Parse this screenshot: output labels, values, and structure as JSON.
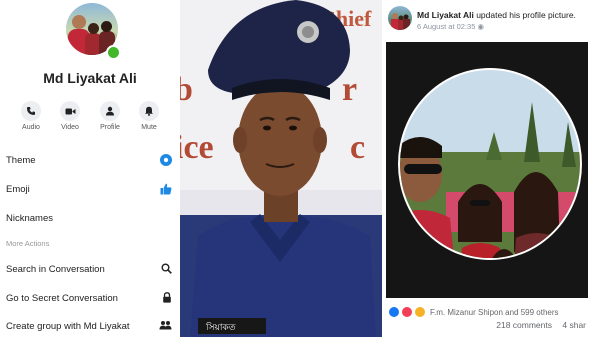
{
  "messenger": {
    "profile_name": "Md Liyakat Ali",
    "actions": [
      {
        "label": "Audio",
        "icon": "phone-icon"
      },
      {
        "label": "Video",
        "icon": "video-camera-icon"
      },
      {
        "label": "Profile",
        "icon": "profile-icon"
      },
      {
        "label": "Mute",
        "icon": "bell-icon"
      }
    ],
    "rows": {
      "theme": "Theme",
      "emoji": "Emoji",
      "nicknames": "Nicknames",
      "more_actions": "More Actions",
      "search": "Search in Conversation",
      "secret": "Go to Secret Conversation",
      "create_group": "Create group with Md Liyakat"
    },
    "colors": {
      "accent": "#1e88e5",
      "online": "#42b72a"
    }
  },
  "police_photo": {
    "background_text": "Chief\nr\nice"
  },
  "post": {
    "author": "Md Liyakat Ali",
    "action_text": " updated his profile picture.",
    "time": "6 August at 02:35",
    "reactions_text": "F.m. Mizanur Shipon and 599 others",
    "comments": "218 comments",
    "shares": "4 shar"
  }
}
